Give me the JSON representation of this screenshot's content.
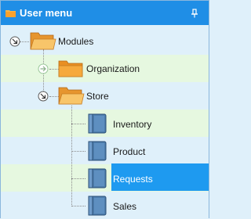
{
  "panel": {
    "title": "User menu",
    "title_icon": "folder-icon",
    "pin_icon": "pin-icon"
  },
  "tree": {
    "modules": {
      "label": "Modules",
      "icon": "folder-open-icon",
      "expander": "collapse-icon"
    },
    "organization": {
      "label": "Organization",
      "icon": "folder-icon",
      "expander": "expand-icon"
    },
    "store": {
      "label": "Store",
      "icon": "folder-open-icon",
      "expander": "collapse-icon"
    },
    "items": [
      {
        "label": "Inventory",
        "icon": "book-icon"
      },
      {
        "label": "Product",
        "icon": "book-icon"
      },
      {
        "label": "Requests",
        "icon": "book-icon",
        "selected": true
      },
      {
        "label": "Sales",
        "icon": "book-icon"
      }
    ]
  },
  "colors": {
    "titlebar": "#1f8ee6",
    "selection": "#1e9af0",
    "row_blue": "#dff0fa",
    "row_green": "#e6f8e0"
  }
}
